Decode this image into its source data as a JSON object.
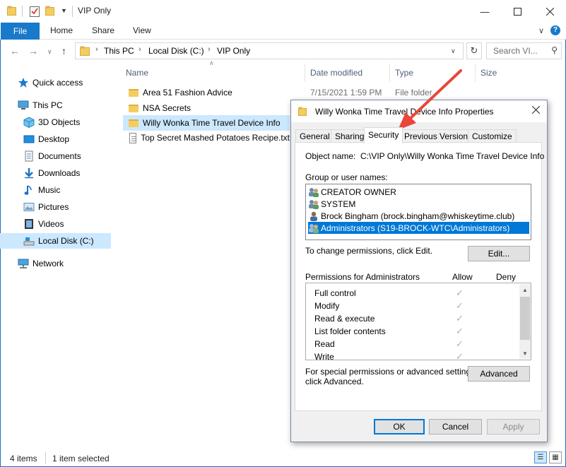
{
  "window": {
    "title": "VIP Only"
  },
  "ribbon": {
    "tabs": [
      "File",
      "Home",
      "Share",
      "View"
    ]
  },
  "address": {
    "crumbs": [
      "This PC",
      "Local Disk (C:)",
      "VIP Only"
    ],
    "search_placeholder": "Search VI..."
  },
  "nav": {
    "items": [
      {
        "label": "Quick access",
        "icon": "star-icon"
      },
      {
        "label": "This PC",
        "icon": "pc-icon"
      },
      {
        "label": "3D Objects",
        "icon": "cube-icon"
      },
      {
        "label": "Desktop",
        "icon": "desktop-icon"
      },
      {
        "label": "Documents",
        "icon": "documents-icon"
      },
      {
        "label": "Downloads",
        "icon": "download-icon"
      },
      {
        "label": "Music",
        "icon": "music-icon"
      },
      {
        "label": "Pictures",
        "icon": "pictures-icon"
      },
      {
        "label": "Videos",
        "icon": "videos-icon"
      },
      {
        "label": "Local Disk (C:)",
        "icon": "drive-icon",
        "selected": true
      },
      {
        "label": "Network",
        "icon": "network-icon"
      }
    ]
  },
  "list": {
    "columns": [
      "Name",
      "Date modified",
      "Type",
      "Size"
    ],
    "rows": [
      {
        "name": "Area 51 Fashion Advice",
        "date": "7/15/2021 1:59 PM",
        "type": "File folder",
        "kind": "folder"
      },
      {
        "name": "NSA Secrets",
        "kind": "folder"
      },
      {
        "name": "Willy Wonka Time Travel Device Info",
        "kind": "folder",
        "selected": true
      },
      {
        "name": "Top Secret Mashed Potatoes Recipe.txt",
        "kind": "file"
      }
    ]
  },
  "status": {
    "items_count": "4 items",
    "selected": "1 item selected"
  },
  "dialog": {
    "title": "Willy Wonka Time Travel Device Info Properties",
    "tabs": [
      "General",
      "Sharing",
      "Security",
      "Previous Versions",
      "Customize"
    ],
    "active_tab": "Security",
    "object_name_label": "Object name:",
    "object_name_value": "C:\\VIP Only\\Willy Wonka Time Travel Device Info",
    "group_label": "Group or user names:",
    "users": [
      "CREATOR OWNER",
      "SYSTEM",
      "Brock Bingham (brock.bingham@whiskeytime.club)",
      "Administrators (S19-BROCK-WTC\\Administrators)"
    ],
    "selected_user_index": 3,
    "change_text": "To change permissions, click Edit.",
    "edit_button": "Edit...",
    "perms_label": "Permissions for Administrators",
    "allow_header": "Allow",
    "deny_header": "Deny",
    "permissions": [
      "Full control",
      "Modify",
      "Read & execute",
      "List folder contents",
      "Read",
      "Write"
    ],
    "special_text_1": "For special permissions or advanced settings,",
    "special_text_2": "click Advanced.",
    "advanced_button": "Advanced",
    "ok_button": "OK",
    "cancel_button": "Cancel",
    "apply_button": "Apply"
  },
  "annotation": {
    "color": "#e8473a"
  }
}
